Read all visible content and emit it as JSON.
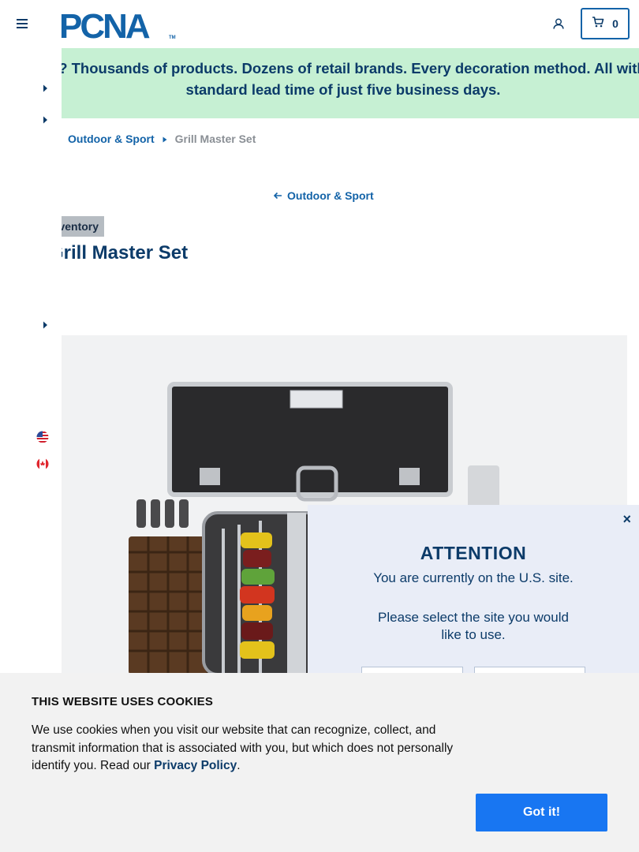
{
  "header": {
    "logo_text": "PCNA",
    "logo_tm": "TM",
    "cart_count": "0"
  },
  "banner": {
    "text": "Wait? Thousands of products. Dozens of retail brands. Every decoration method. All with a standard lead time of just five business days."
  },
  "breadcrumb": {
    "category": "Outdoor & Sport",
    "current": "Grill Master Set"
  },
  "back_link": {
    "label": "Outdoor & Sport"
  },
  "product": {
    "inventory_badge": "Inventory",
    "title": "Grill Master Set"
  },
  "attention_modal": {
    "close_label": "×",
    "title": "ATTENTION",
    "line1": "You are currently on the U.S. site.",
    "line2": "Please select the site you would like to use."
  },
  "cookie_banner": {
    "title": "THIS WEBSITE USES COOKIES",
    "text": "We use cookies when you visit our website that can recognize, collect, and transmit information that is associated with you, but which does not personally identify you. Read our",
    "link_label": "Privacy Policy",
    "trailing": ".",
    "button_label": "Got it!"
  },
  "colors": {
    "brand_blue": "#1363a8",
    "navy": "#0c3b69",
    "banner_green": "#c6f0d3",
    "cta_blue": "#1876f2"
  }
}
